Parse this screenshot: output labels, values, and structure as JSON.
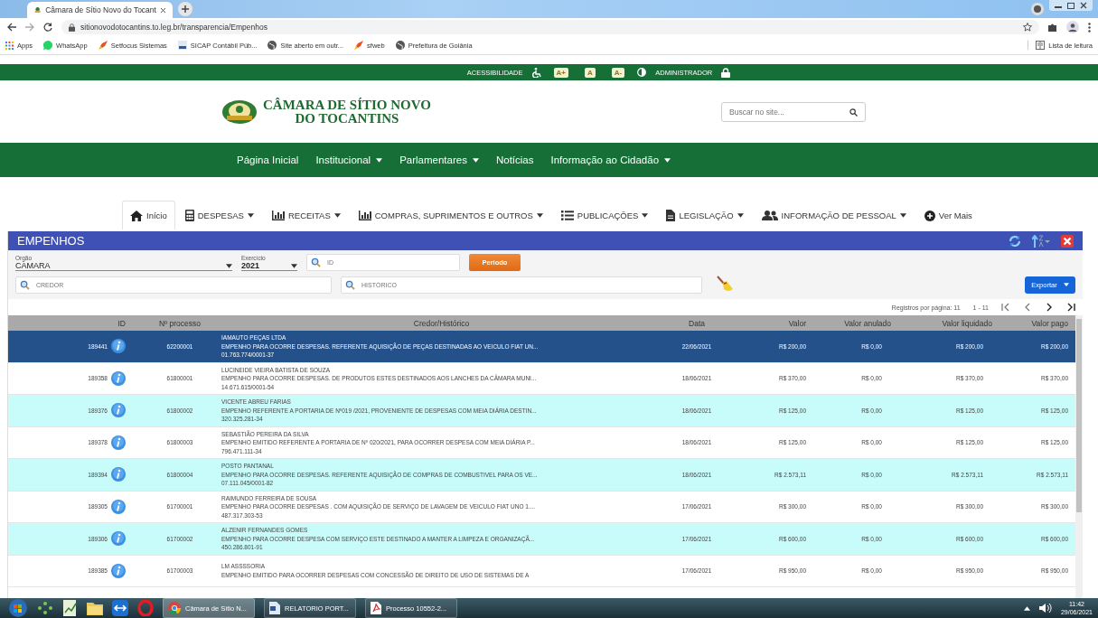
{
  "browser": {
    "tab_title": "Câmara de Sítio Novo do Tocant",
    "address": "sitionovodotocantins.to.leg.br/transparencia/Empenhos",
    "bookmarks": [
      {
        "label": "Apps",
        "kind": "apps"
      },
      {
        "label": "WhatsApp",
        "kind": "chat"
      },
      {
        "label": "Setfocus Sistemas",
        "kind": "rocket"
      },
      {
        "label": "SICAP Contábil Púb...",
        "kind": "doc"
      },
      {
        "label": "Site aberto em outr...",
        "kind": "globe"
      },
      {
        "label": "sfweb",
        "kind": "rocket"
      },
      {
        "label": "Prefeitura de Goiânia",
        "kind": "globe"
      }
    ],
    "reading_list": "Lista de leitura"
  },
  "topbar": {
    "accessibility": "ACESSIBILIDADE",
    "font_buttons": [
      "A+",
      "A",
      "A-"
    ],
    "admin": "ADMINISTRADOR"
  },
  "header": {
    "logo_lines": [
      "CÂMARA DE SÍTIO NOVO",
      "DO TOCANTINS"
    ],
    "search": {
      "placeholder": "Buscar no site..."
    }
  },
  "main_nav": [
    {
      "label": "Página Inicial",
      "dropdown": false
    },
    {
      "label": "Institucional",
      "dropdown": true
    },
    {
      "label": "Parlamentares",
      "dropdown": true
    },
    {
      "label": "Notícias",
      "dropdown": false
    },
    {
      "label": "Informação ao Cidadão",
      "dropdown": true
    }
  ],
  "tabs": [
    {
      "label": "Início",
      "kind": "home",
      "dropdown": false,
      "selected": true
    },
    {
      "label": "DESPESAS",
      "kind": "calculator",
      "dropdown": true,
      "selected": false
    },
    {
      "label": "RECEITAS",
      "kind": "chart",
      "dropdown": true,
      "selected": false
    },
    {
      "label": "COMPRAS, SUPRIMENTOS E OUTROS",
      "kind": "chart",
      "dropdown": true,
      "selected": false
    },
    {
      "label": "PUBLICAÇÕES",
      "kind": "list",
      "dropdown": true,
      "selected": false
    },
    {
      "label": "LEGISLAÇÃO",
      "kind": "file",
      "dropdown": true,
      "selected": false
    },
    {
      "label": "INFORMAÇÃO DE PESSOAL",
      "kind": "users",
      "dropdown": true,
      "selected": false
    },
    {
      "label": "Ver Mais",
      "kind": "plus",
      "dropdown": false,
      "selected": false
    }
  ],
  "panel": {
    "title": "EMPENHOS",
    "filters": {
      "orgao": {
        "label": "Orgão",
        "value": "CAMARA"
      },
      "exercicio": {
        "label": "Exercício",
        "value": "2021"
      },
      "id": {
        "placeholder": "ID"
      },
      "period_button": "Período",
      "credor": {
        "placeholder": "CREDOR"
      },
      "historico": {
        "placeholder": "HISTÓRICO"
      },
      "export_button": "Exportar"
    },
    "pagination": {
      "per_page": "Registros por página: 11",
      "range": "1 - 11"
    },
    "table": {
      "columns": [
        "ID",
        "Nº processo",
        "Credor/Histórico",
        "Data",
        "Valor",
        "Valor anulado",
        "Valor liquidado",
        "Valor pago"
      ],
      "rows": [
        {
          "id": "189441",
          "process": "62200001",
          "creditor": "IAMAUTO PEÇAS LTDA",
          "history": "EMPENHO PARA OCORRE DESPESAS. REFERENTE AQUISIÇÃO DE PEÇAS DESTINADAS AO VEICULO FIAT UN...",
          "document": "01.763.774/0001-37",
          "date": "22/06/2021",
          "value": "R$ 200,00",
          "cancelled": "R$ 0,00",
          "settled": "R$ 200,00",
          "paid": "R$ 200,00",
          "selected": true
        },
        {
          "id": "189358",
          "process": "61800001",
          "creditor": "LUCINEIDE VIEIRA BATISTA DE SOUZA",
          "history": "EMPENHO PARA OCORRE DESPESAS. DE PRODUTOS ESTES DESTINADOS AOS LANCHES DA CÂMARA MUNI...",
          "document": "14.671.615/0001-54",
          "date": "18/06/2021",
          "value": "R$ 370,00",
          "cancelled": "R$ 0,00",
          "settled": "R$ 370,00",
          "paid": "R$ 370,00",
          "selected": false
        },
        {
          "id": "189376",
          "process": "61800002",
          "creditor": "VICENTE ABREU FARIAS",
          "history": "EMPENHO REFERENTE A PORTARIA DE Nº019 /2021, PROVENIENTE DE DESPESAS COM MEIA DIÁRIA DESTIN...",
          "document": "320.325.281-34",
          "date": "18/06/2021",
          "value": "R$ 125,00",
          "cancelled": "R$ 0,00",
          "settled": "R$ 125,00",
          "paid": "R$ 125,00",
          "selected": false
        },
        {
          "id": "189378",
          "process": "61800003",
          "creditor": "SEBASTIÃO PEREIRA DA SILVA",
          "history": "EMPENHO EMITIDO REFERENTE A PORTARIA DE Nº 020/2021, PARA OCORRER DESPESA COM MEIA DIÁRIA P...",
          "document": "796.471.111-34",
          "date": "18/06/2021",
          "value": "R$ 125,00",
          "cancelled": "R$ 0,00",
          "settled": "R$ 125,00",
          "paid": "R$ 125,00",
          "selected": false
        },
        {
          "id": "189394",
          "process": "61800004",
          "creditor": "POSTO PANTANAL",
          "history": "EMPENHO PARA OCORRE DESPESAS. REFERENTE AQUISIÇÃO DE COMPRAS DE COMBUSTIVEL PARA OS VE...",
          "document": "07.111.045/0001-82",
          "date": "18/06/2021",
          "value": "R$ 2.573,11",
          "cancelled": "R$ 0,00",
          "settled": "R$ 2.573,11",
          "paid": "R$ 2.573,11",
          "selected": false
        },
        {
          "id": "189305",
          "process": "61700001",
          "creditor": "RAIMUNDO FERREIRA DE SOUSA",
          "history": "EMPENHO PARA OCORRE DESPESAS . COM AQUISIÇÃO DE SERVIÇO DE LAVAGEM DE VEICULO FIAT UNO 1....",
          "document": "487.317.303-53",
          "date": "17/06/2021",
          "value": "R$ 300,00",
          "cancelled": "R$ 0,00",
          "settled": "R$ 300,00",
          "paid": "R$ 300,00",
          "selected": false
        },
        {
          "id": "189306",
          "process": "61700002",
          "creditor": "ALZENIR FERNANDES GOMES",
          "history": "EMPENHO PARA OCORRE DESPESA COM SERVIÇO ESTE DESTINADO A MANTER A LIMPEZA E ORGANIZAÇÃ...",
          "document": "450.286.801-91",
          "date": "17/06/2021",
          "value": "R$ 600,00",
          "cancelled": "R$ 0,00",
          "settled": "R$ 600,00",
          "paid": "R$ 600,00",
          "selected": false
        },
        {
          "id": "189385",
          "process": "61700003",
          "creditor": "LM ASSSSORIA",
          "history": "EMPENHO EMITIDO PARA OCORRER DESPESAS COM CONCESSÃO DE DIREITO DE USO DE SISTEMAS DE A",
          "date": "17/06/2021",
          "value": "R$ 950,00",
          "cancelled": "R$ 0,00",
          "settled": "R$ 950,00",
          "paid": "R$ 950,00",
          "selected": false
        }
      ]
    }
  },
  "taskbar": {
    "windows": [
      {
        "label": "Câmara de Sítio N...",
        "kind": "chrome",
        "selected": true
      },
      {
        "label": "RELATORIO PORT...",
        "kind": "word",
        "selected": false
      },
      {
        "label": "Processo 10552-2...",
        "kind": "pdf",
        "selected": false
      }
    ],
    "time": "11:42",
    "date": "29/06/2021"
  }
}
